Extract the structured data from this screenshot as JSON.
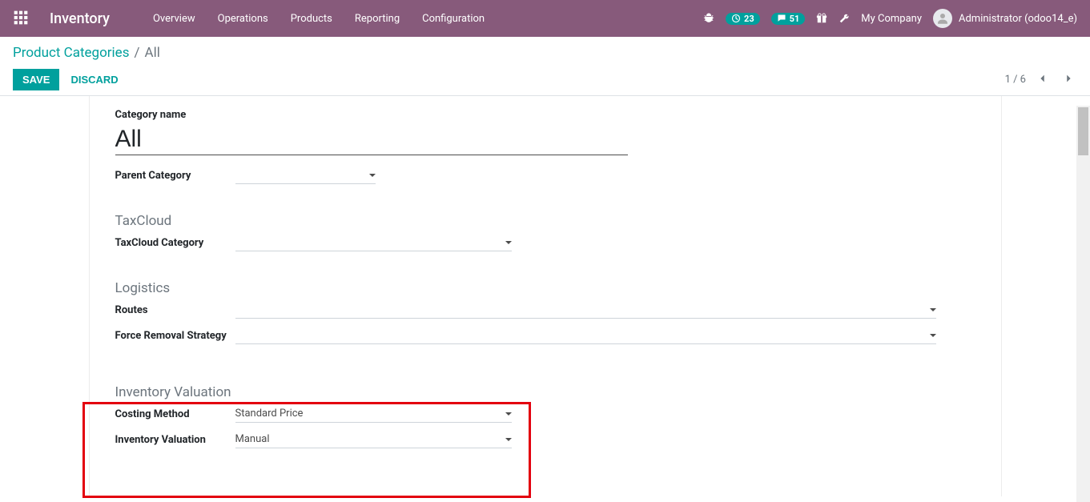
{
  "navbar": {
    "brand": "Inventory",
    "menu": [
      "Overview",
      "Operations",
      "Products",
      "Reporting",
      "Configuration"
    ],
    "badges": {
      "clock": "23",
      "chat": "51"
    },
    "company": "My Company",
    "user": "Administrator (odoo14_e)"
  },
  "breadcrumb": {
    "parent": "Product Categories",
    "current": "All"
  },
  "buttons": {
    "save": "Save",
    "discard": "Discard"
  },
  "pager": {
    "text": "1 / 6"
  },
  "form": {
    "category_name_label": "Category name",
    "category_name_value": "All",
    "parent_category_label": "Parent Category",
    "parent_category_value": "",
    "sections": {
      "taxcloud": {
        "title": "TaxCloud",
        "taxcloud_category_label": "TaxCloud Category",
        "taxcloud_category_value": ""
      },
      "logistics": {
        "title": "Logistics",
        "routes_label": "Routes",
        "routes_value": "",
        "force_removal_label": "Force Removal Strategy",
        "force_removal_value": ""
      },
      "inventory_valuation": {
        "title": "Inventory Valuation",
        "costing_method_label": "Costing Method",
        "costing_method_value": "Standard Price",
        "inventory_valuation_label": "Inventory Valuation",
        "inventory_valuation_value": "Manual"
      }
    }
  }
}
